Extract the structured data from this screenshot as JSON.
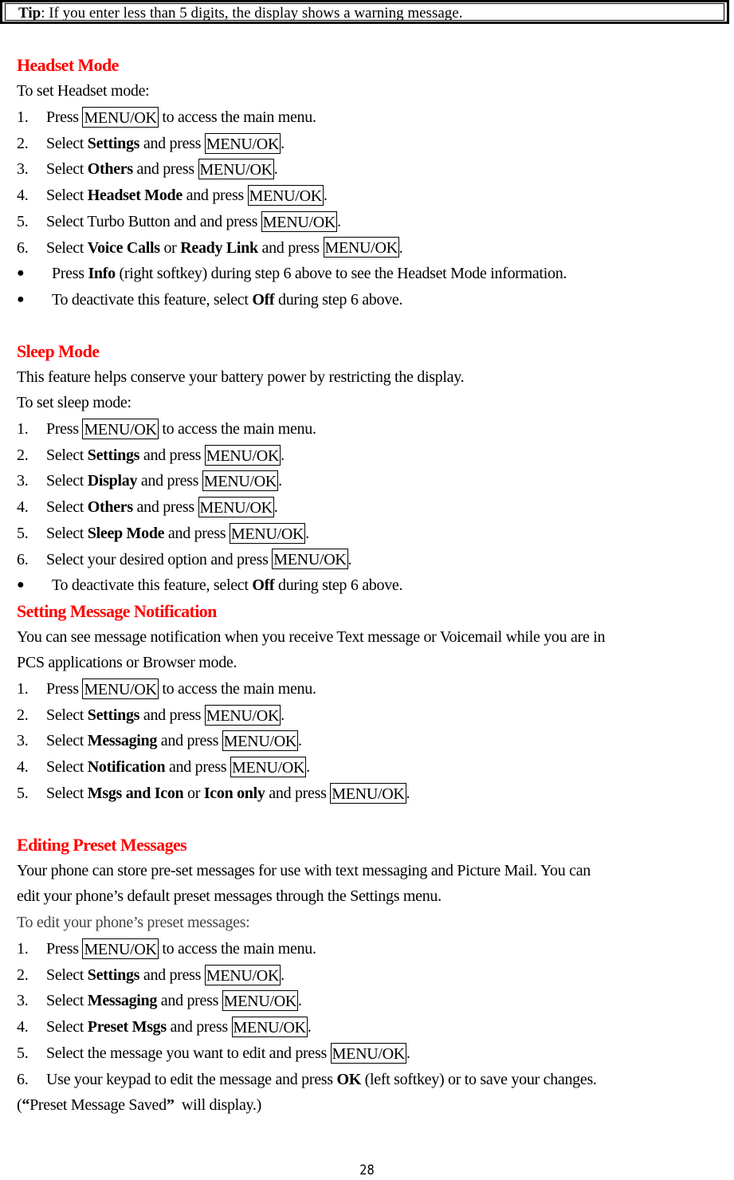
{
  "tip": {
    "label": "Tip",
    "text": ": If you enter less than 5 digits, the display shows a warning message."
  },
  "key_label": "MENU/OK",
  "sections": {
    "headset": {
      "title": "Headset Mode",
      "intro": "To set Headset mode:",
      "steps": [
        {
          "num": "1.",
          "pre": "Press ",
          "key": "MENU/OK",
          "post": " to access the main menu."
        },
        {
          "num": "2.",
          "pre": "Select ",
          "bold": "Settings",
          "mid": " and press ",
          "key": "MENU/OK",
          "post": "."
        },
        {
          "num": "3.",
          "pre": "Select ",
          "bold": "Others",
          "mid": " and press ",
          "key": "MENU/OK",
          "post": "."
        },
        {
          "num": "4.",
          "pre": "Select ",
          "bold": "Headset Mode",
          "mid": " and press ",
          "key": "MENU/OK",
          "post": "."
        },
        {
          "num": "5.",
          "pre": "Select Turbo Button and and press ",
          "key": "MENU/OK",
          "post": "."
        },
        {
          "num": "6.",
          "pre": "Select ",
          "bold": "Voice Calls",
          "mid": " or ",
          "bold2": "Ready Link",
          "mid2": " and press ",
          "key": "MENU/OK",
          "post": "."
        }
      ],
      "bullets": [
        {
          "pre": "Press ",
          "bold": "Info",
          "post": " (right softkey) during step 6 above to see the Headset Mode information."
        },
        {
          "pre": "To deactivate this feature, select ",
          "bold": "Off",
          "post": " during step 6 above."
        }
      ]
    },
    "sleep": {
      "title": "Sleep Mode",
      "desc": "This feature helps conserve your battery power by restricting the display.",
      "intro": "To set sleep mode:",
      "steps": [
        {
          "num": "1.",
          "pre": "Press ",
          "key": "MENU/OK",
          "post": " to access the main menu."
        },
        {
          "num": "2.",
          "pre": "Select ",
          "bold": "Settings",
          "mid": " and press ",
          "key": "MENU/OK",
          "post": "."
        },
        {
          "num": "3.",
          "pre": "Select ",
          "bold": "Display",
          "mid": " and press ",
          "key": "MENU/OK",
          "post": "."
        },
        {
          "num": "4.",
          "pre": "Select ",
          "bold": "Others",
          "mid": " and press ",
          "key": "MENU/OK",
          "post": "."
        },
        {
          "num": "5.",
          "pre": "Select ",
          "bold": "Sleep Mode",
          "mid": " and press ",
          "key": "MENU/OK",
          "post": "."
        },
        {
          "num": "6.",
          "pre": "Select your desired option and press ",
          "key": "MENU/OK",
          "post": "."
        }
      ],
      "bullets": [
        {
          "pre": "To deactivate this feature, select ",
          "bold": "Off",
          "post": " during step 6 above."
        }
      ]
    },
    "notification": {
      "title": "Setting Message Notification",
      "desc1": "You can see message notification when you receive Text message or Voicemail while you are in",
      "desc2": "PCS applications or Browser mode.",
      "steps": [
        {
          "num": "1.",
          "pre": "Press ",
          "key": "MENU/OK",
          "post": " to access the main menu."
        },
        {
          "num": "2.",
          "pre": "Select ",
          "bold": "Settings",
          "mid": " and press ",
          "key": "MENU/OK",
          "post": "."
        },
        {
          "num": "3.",
          "pre": "Select ",
          "bold": "Messaging",
          "mid": " and press ",
          "key": "MENU/OK",
          "post": "."
        },
        {
          "num": "4.",
          "pre": "Select ",
          "bold": "Notification",
          "mid": " and press ",
          "key": "MENU/OK",
          "post": "."
        },
        {
          "num": "5.",
          "pre": "Select ",
          "bold": "Msgs and Icon",
          "mid": " or ",
          "bold2": "Icon only",
          "mid2": " and press ",
          "key": "MENU/OK",
          "post": "."
        }
      ]
    },
    "preset": {
      "title": "Editing Preset Messages",
      "desc1": "Your phone can store pre-set messages for use with text messaging and Picture Mail. You can",
      "desc2": "edit your phone’s default preset messages through the Settings menu.",
      "intro": "To edit your phone’s preset messages:",
      "steps": [
        {
          "num": "1.",
          "pre": "Press ",
          "key": "MENU/OK",
          "post": " to access the main menu."
        },
        {
          "num": "2.",
          "pre": "Select ",
          "bold": "Settings",
          "mid": " and press ",
          "key": "MENU/OK",
          "post": "."
        },
        {
          "num": "3.",
          "pre": "Select ",
          "bold": "Messaging",
          "mid": " and press ",
          "key": "MENU/OK",
          "post": "."
        },
        {
          "num": "4.",
          "pre": "Select ",
          "bold": "Preset Msgs",
          "mid": " and press ",
          "key": "MENU/OK",
          "post": "."
        },
        {
          "num": "5.",
          "pre": "Select the message you want to edit and press ",
          "key": "MENU/OK",
          "post": "."
        },
        {
          "num": "6.",
          "pre": "Use your keypad to edit the message and press ",
          "bold": "OK",
          "post": " (left softkey) or to save your changes."
        }
      ],
      "note_open": "(",
      "note_quote_open": "“",
      "note_text": "Preset Message Saved",
      "note_quote_close": "”",
      "note_close": "  will display.)"
    }
  },
  "page_number": "28",
  "colors": {
    "heading": "#ff0000",
    "text": "#000000"
  }
}
